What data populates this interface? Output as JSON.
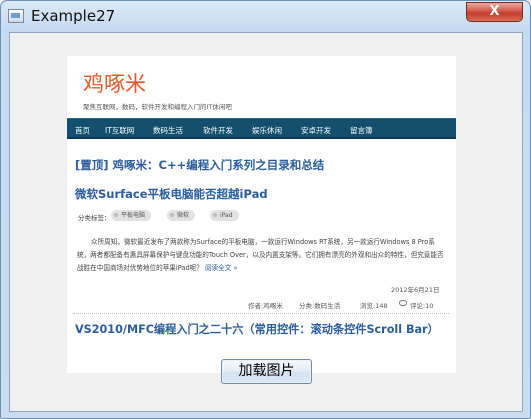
{
  "window": {
    "title": "Example27",
    "close_label": "X"
  },
  "blog": {
    "title": "鸡啄米",
    "subtitle": "聚焦互联网，数码，软件开发和编程入门的IT休闲吧",
    "nav": [
      "首页",
      "IT互联网",
      "数码生活",
      "软件开发",
      "娱乐休闲",
      "安卓开发",
      "留言簿"
    ],
    "posts": {
      "top": "[置顶] 鸡啄米：C++编程入门系列之目录和总结",
      "first_title": "微软Surface平板电脑能否超越iPad",
      "category_label": "分类标签：",
      "tags": [
        "平板电脑",
        "微软",
        "iPad"
      ],
      "excerpt": "众所周知，微软最近发布了两款称为Surface的平板电脑，一款运行Windows RT系统，另一款运行Windows 8 Pro系统，两者都配备有惠具屏幕保护与键盘功能的Touch Over，以及内置支架等。它们拥有漂亮的外观和出众的特性，但究竟能否战胜在中国商场对优势地位的苹果iPad呢？",
      "read_more": "阅读全文 »",
      "date": "2012年6月21日",
      "author": "作者:鸡啄米",
      "category": "分类:数码生活",
      "views": "浏览:148",
      "comments": "评论:10",
      "second_title": "VS2010/MFC编程入门之二十六（常用控件：滚动条控件Scroll Bar）"
    }
  },
  "load_button": "加载图片",
  "icons": {
    "app": "window-app-icon",
    "comment": "comment-icon"
  },
  "colors": {
    "blog_title": "#e8562a",
    "nav_bg": "#12506e",
    "post_link": "#2a5d9c",
    "close_button": "#c23d2d"
  }
}
